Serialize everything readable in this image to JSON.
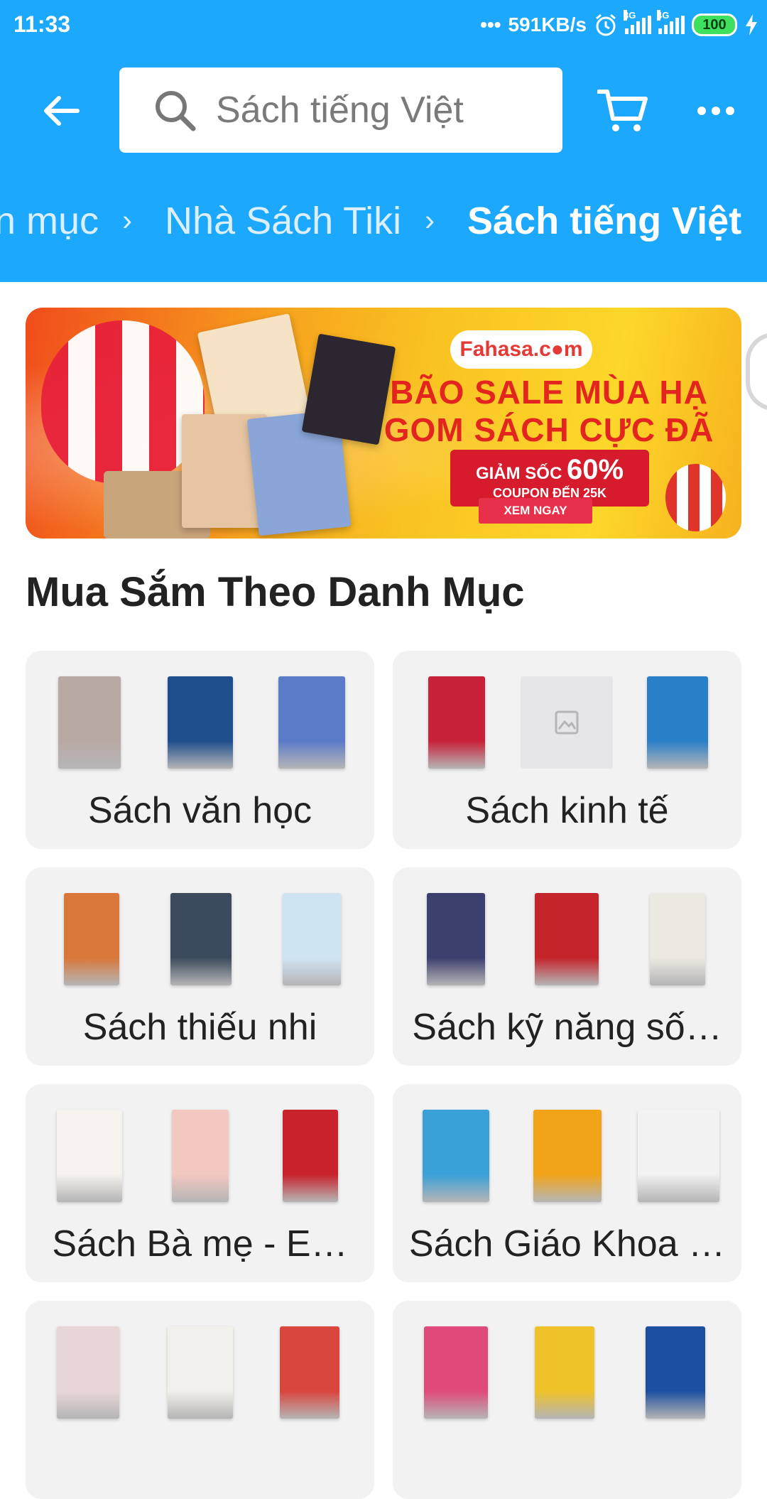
{
  "status_bar": {
    "time": "11:33",
    "net_speed": "591KB/s",
    "signal_1_label": "3G",
    "signal_2_label": "4G",
    "battery": "100"
  },
  "toolbar": {
    "back_icon": "arrow-left-icon",
    "search_placeholder": "Sách tiếng Việt",
    "cart_icon": "cart-icon",
    "more_icon": "more-horizontal-icon"
  },
  "breadcrumb": {
    "items": [
      "n mục",
      "Nhà Sách Tiki",
      "Sách tiếng Việt"
    ]
  },
  "banner": {
    "brand": "Fahasa.c●m",
    "headline_1": "BÃO SALE MÙA HẠ",
    "headline_2": "GOM SÁCH CỰC ĐÃ",
    "discount_prefix": "GIẢM SỐC",
    "discount_value": "60%",
    "coupon": "COUPON ĐẾN 25K",
    "cta": "XEM NGAY"
  },
  "section": {
    "title": "Mua Sắm Theo Danh Mục"
  },
  "categories": [
    {
      "label": "Sách văn học",
      "thumbs": [
        "#b9a9a5",
        "#1f4e8c",
        "#5b7ac7"
      ]
    },
    {
      "label": "Sách kinh tế",
      "thumbs": [
        "#c8213a",
        "placeholder",
        "#2a7fc9"
      ]
    },
    {
      "label": "Sách thiếu nhi",
      "thumbs": [
        "#d9783a",
        "#3b4a5c",
        "#cfe4f3"
      ]
    },
    {
      "label": "Sách kỹ năng số…",
      "thumbs": [
        "#3d3f6e",
        "#c4242a",
        "#ece9e2"
      ]
    },
    {
      "label": "Sách Bà mẹ - E…",
      "thumbs": [
        "#f6f3ee",
        "#f3c8c0",
        "#c8222b"
      ]
    },
    {
      "label": "Sách Giáo Khoa …",
      "thumbs": [
        "#3aa0d8",
        "#f2a419",
        "#f2f2f2"
      ]
    },
    {
      "label": "",
      "thumbs": [
        "#e8d6d6",
        "#f2f0ea",
        "#d9463e"
      ]
    },
    {
      "label": "",
      "thumbs": [
        "#e04a7a",
        "#f0c22a",
        "#1c4fa0"
      ]
    }
  ]
}
